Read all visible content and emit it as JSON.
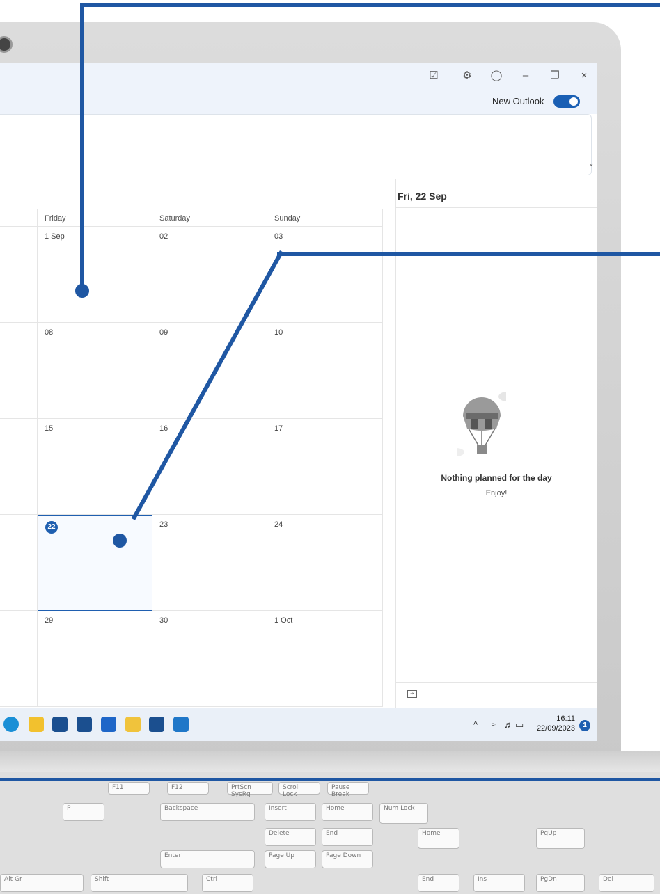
{
  "window": {
    "new_outlook_label": "New Outlook",
    "new_outlook_enabled": true
  },
  "calendar": {
    "day_headers": [
      "Friday",
      "Saturday",
      "Sunday"
    ],
    "weeks": [
      [
        "1 Sep",
        "02",
        "03"
      ],
      [
        "08",
        "09",
        "10"
      ],
      [
        "15",
        "16",
        "17"
      ],
      [
        "22",
        "23",
        "24"
      ],
      [
        "29",
        "30",
        "1 Oct"
      ]
    ],
    "today": "22"
  },
  "side_panel": {
    "date": "Fri, 22 Sep",
    "empty_title": "Nothing planned for the day",
    "empty_subtitle": "Enjoy!"
  },
  "taskbar": {
    "time": "16:11",
    "date": "22/09/2023",
    "notification_count": "1"
  },
  "keyboard": {
    "keys": [
      "F11",
      "F12",
      "PrtScn SysRq",
      "Scroll Lock",
      "Pause Break",
      "Backspace",
      "Insert",
      "Home",
      "Num Lock",
      "Delete",
      "End",
      "Home",
      "PgUp",
      "Enter",
      "Page Up",
      "Page Down",
      "Shift",
      "End",
      "PgDn",
      "Alt Gr",
      "Ctrl",
      "Ins",
      "Del",
      "P"
    ]
  }
}
